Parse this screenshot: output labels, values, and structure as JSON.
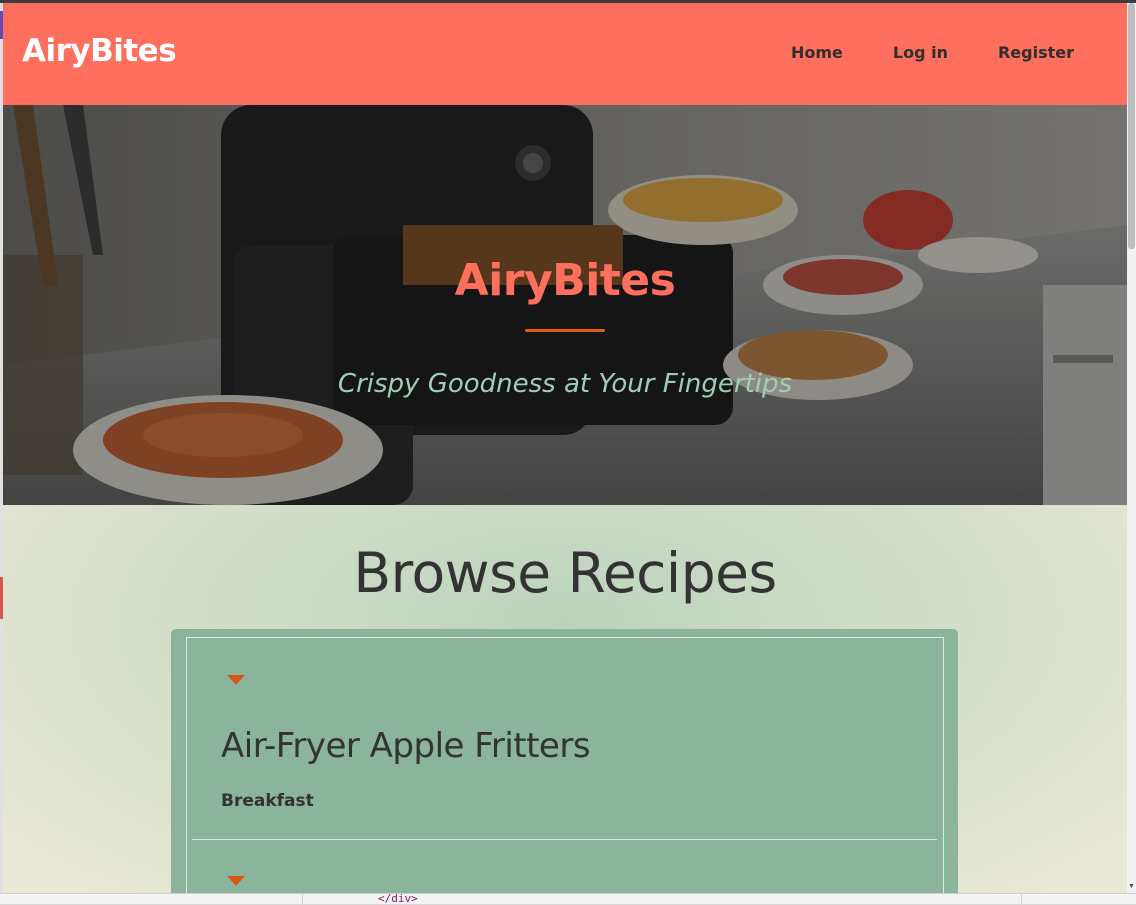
{
  "navbar": {
    "brand": "AiryBites",
    "links": [
      "Home",
      "Log in",
      "Register"
    ]
  },
  "hero": {
    "title": "AiryBites",
    "subtitle": "Crispy Goodness at Your Fingertips"
  },
  "main": {
    "heading": "Browse Recipes",
    "recipes": [
      {
        "name": "Air-Fryer Apple Fritters",
        "category": "Breakfast"
      }
    ]
  },
  "devtools": {
    "code_snippet": "</div>"
  },
  "colors": {
    "navbar_bg": "#ff6f5e",
    "brand_text": "#ffffff",
    "hero_title": "#ff6f5e",
    "hero_underline": "#e05a12",
    "hero_subtitle": "#9fcfb5",
    "card_bg": "#8bb49c",
    "caret": "#d45a12",
    "text_dark": "#333333"
  },
  "icons": {
    "expand": "caret-down-icon",
    "scroll_down": "scroll-down-arrow-icon"
  }
}
